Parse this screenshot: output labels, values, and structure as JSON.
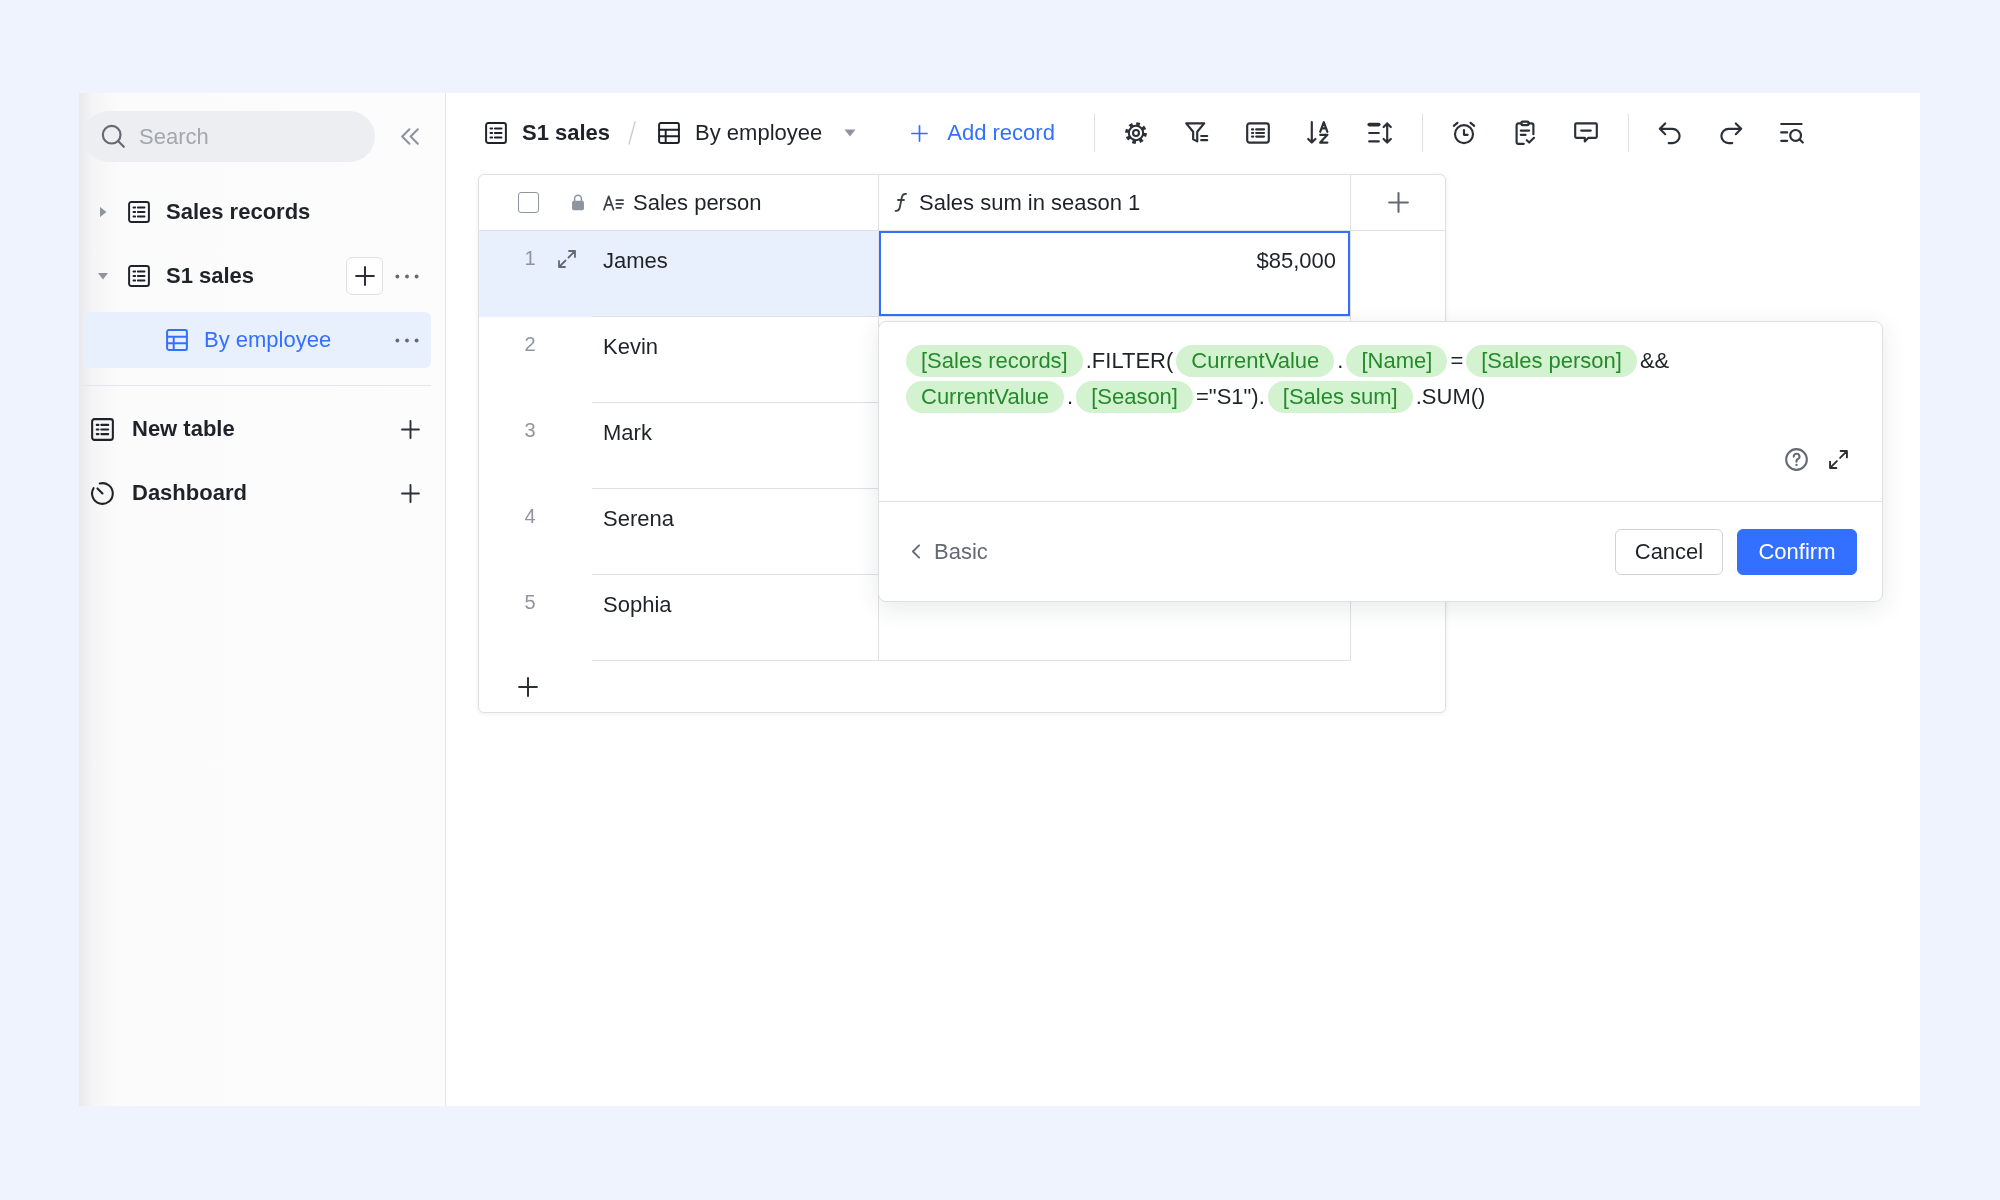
{
  "sidebar": {
    "search": {
      "placeholder": "Search"
    },
    "tree": [
      {
        "kind": "table",
        "label": "Sales records",
        "expanded": false,
        "selected": false,
        "hovered": false
      },
      {
        "kind": "table",
        "label": "S1 sales",
        "expanded": true,
        "selected": false,
        "hovered": true,
        "children": [
          {
            "kind": "view",
            "label": "By employee",
            "selected": true,
            "hovered": false
          }
        ]
      }
    ],
    "sections": [
      {
        "kind": "table",
        "label": "New table"
      },
      {
        "kind": "dashboard",
        "label": "Dashboard"
      }
    ]
  },
  "toolbar": {
    "table": "S1 sales",
    "view": "By employee",
    "add_record": "Add record"
  },
  "table": {
    "select_all": {
      "checked": false
    },
    "columns": [
      {
        "kind": "text",
        "label": "Sales person",
        "locked": true
      },
      {
        "kind": "formula",
        "label": "Sales sum in season 1"
      }
    ],
    "rows": [
      {
        "number": "1",
        "cells": [
          "James",
          "$85,000"
        ],
        "selected": true
      },
      {
        "number": "2",
        "cells": [
          "Kevin"
        ],
        "selected": false
      },
      {
        "number": "3",
        "cells": [
          "Mark"
        ],
        "selected": false
      },
      {
        "number": "4",
        "cells": [
          "Serena"
        ],
        "selected": false
      },
      {
        "number": "5",
        "cells": [
          "Sophia"
        ],
        "selected": false
      }
    ]
  },
  "formula_editor": {
    "lines": [
      [
        {
          "kind": "field",
          "text": "[Sales records]"
        },
        {
          "kind": "code",
          "text": ".FILTER("
        },
        {
          "kind": "field",
          "text": "CurrentValue"
        },
        {
          "kind": "code",
          "text": "."
        },
        {
          "kind": "field",
          "text": "[Name]"
        },
        {
          "kind": "code",
          "text": "="
        },
        {
          "kind": "field",
          "text": "[Sales person]"
        },
        {
          "kind": "code",
          "text": "&&"
        }
      ],
      [
        {
          "kind": "field",
          "text": "CurrentValue"
        },
        {
          "kind": "code",
          "text": "."
        },
        {
          "kind": "field",
          "text": "[Season]"
        },
        {
          "kind": "code",
          "text": "=\"S1\")."
        },
        {
          "kind": "field",
          "text": "[Sales sum]"
        },
        {
          "kind": "code",
          "text": ".SUM()"
        }
      ]
    ],
    "back": "Basic",
    "buttons": [
      {
        "kind": "secondary",
        "label": "Cancel"
      },
      {
        "kind": "primary",
        "label": "Confirm"
      }
    ]
  }
}
